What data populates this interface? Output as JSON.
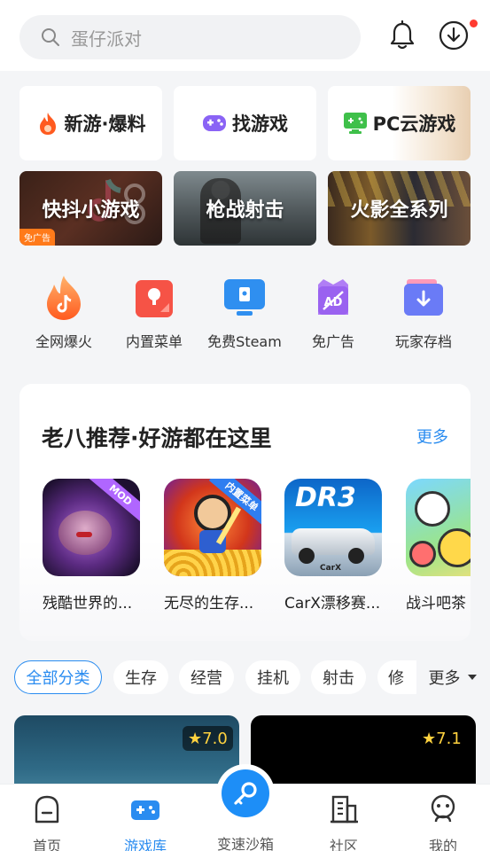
{
  "search": {
    "placeholder": "蛋仔派对"
  },
  "header": {
    "bell_icon": "bell-icon",
    "download_icon": "download-icon",
    "has_notification": true
  },
  "entry_cards": [
    {
      "label": "新游·爆料",
      "icon": "fire-icon",
      "accent": "#ff5a1f"
    },
    {
      "label": "找游戏",
      "icon": "gamepad-icon",
      "accent": "#8a63f5"
    },
    {
      "label": "PC云游戏",
      "icon": "monitor-gamepad-icon",
      "accent": "#3fc04a"
    },
    {
      "label": "快抖小游戏",
      "icon": "tiktok-icon",
      "tag": "免广告"
    },
    {
      "label": "枪战射击",
      "icon": ""
    },
    {
      "label": "火影全系列",
      "icon": ""
    }
  ],
  "quick_links": [
    {
      "label": "全网爆火",
      "icon": "flame-icon"
    },
    {
      "label": "内置菜单",
      "icon": "menu-card-icon"
    },
    {
      "label": "免费Steam",
      "icon": "steam-monitor-icon"
    },
    {
      "label": "免广告",
      "icon": "ad-block-icon"
    },
    {
      "label": "玩家存档",
      "icon": "save-folder-icon"
    }
  ],
  "recommend": {
    "title": "老八推荐·好游都在这里",
    "more": "更多",
    "games": [
      {
        "name": "残酷世界的...",
        "badge": "MOD"
      },
      {
        "name": "无尽的生存...",
        "badge": "内置菜单"
      },
      {
        "name": "CarX漂移赛...",
        "badge": "",
        "logo": "DR3",
        "sublogo": "CarX"
      },
      {
        "name": "战斗吧茶",
        "badge": ""
      }
    ]
  },
  "categories": {
    "items": [
      "全部分类",
      "生存",
      "经营",
      "挂机",
      "射击",
      "修"
    ],
    "active": "全部分类",
    "more": "更多"
  },
  "game_cards": [
    {
      "rating": "7.0"
    },
    {
      "rating": "7.1"
    }
  ],
  "nav": {
    "items": [
      {
        "label": "首页",
        "icon": "home-icon"
      },
      {
        "label": "游戏库",
        "icon": "gamepad-icon",
        "active": true
      },
      {
        "label": "变速沙箱",
        "icon": "key-icon"
      },
      {
        "label": "社区",
        "icon": "building-icon"
      },
      {
        "label": "我的",
        "icon": "profile-icon"
      }
    ]
  },
  "colors": {
    "accent": "#2a8cf0",
    "notification": "#ff3b30",
    "rating": "#ffd23f"
  }
}
